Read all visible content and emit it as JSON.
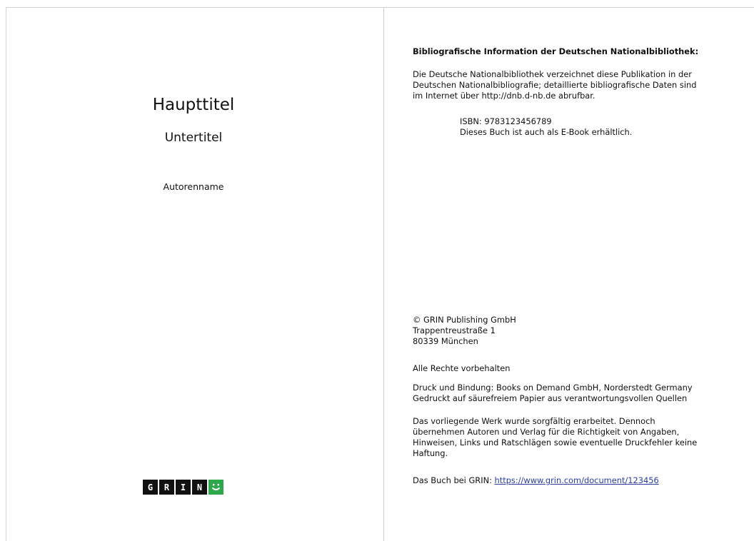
{
  "left_page": {
    "main_title": "Haupttitel",
    "subtitle": "Untertitel",
    "author": "Autorenname",
    "logo": {
      "letters": [
        "G",
        "R",
        "I",
        "N"
      ],
      "smile_icon": "smiley-icon",
      "smile_color": "#2ea84a",
      "box_color": "#111111"
    }
  },
  "right_page": {
    "biblio_heading": "Bibliografische Information der Deutschen Nationalbibliothek:",
    "biblio_lines": [
      "Die Deutsche Nationalbibliothek verzeichnet diese Publikation in der",
      "Deutschen Nationalbibliografie; detaillierte bibliografische Daten sind",
      "im Internet über http://dnb.d-nb.de abrufbar."
    ],
    "isbn": "ISBN: 9783123456789",
    "ebook_note": "Dieses Buch ist auch als E-Book erhältlich.",
    "imprint_lines": [
      "© GRIN Publishing GmbH",
      "Trappentreustraße 1",
      "80339 München"
    ],
    "rights": "Alle Rechte vorbehalten",
    "printing_lines": [
      "Druck und Bindung: Books on Demand GmbH, Norderstedt Germany",
      "Gedruckt auf säurefreiem Papier aus verantwortungsvollen Quellen"
    ],
    "disclaimer_lines": [
      "Das vorliegende Werk wurde sorgfältig erarbeitet. Dennoch",
      "übernehmen Autoren und Verlag für die Richtigkeit von Angaben,",
      "Hinweisen, Links und Ratschlägen sowie eventuelle Druckfehler keine",
      "Haftung."
    ],
    "grin_link_prefix": "Das Buch bei GRIN: ",
    "grin_link_url": "https://www.grin.com/document/123456",
    "link_color": "#2a3f9c"
  }
}
